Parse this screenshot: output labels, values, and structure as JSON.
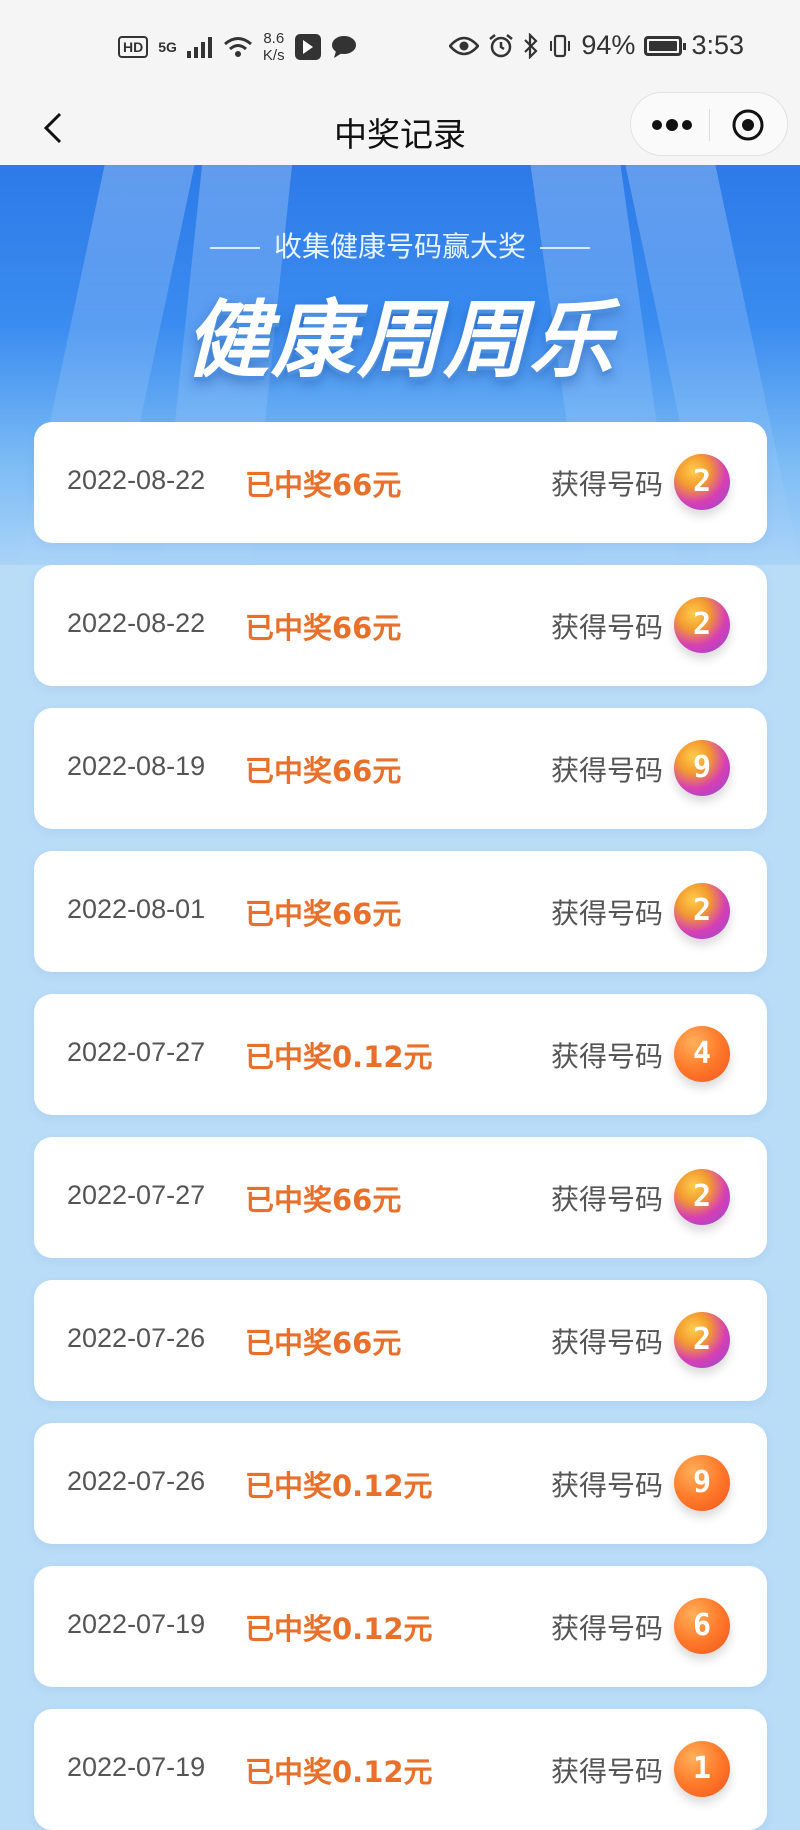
{
  "status_bar": {
    "hd": "HD",
    "net_type": "5G",
    "speed_value": "8.6",
    "speed_unit": "K/s",
    "battery": "94%",
    "time": "3:53"
  },
  "nav": {
    "title": "中奖记录",
    "back_icon": "chevron-left-icon",
    "more_icon": "more-dots-icon",
    "close_icon": "target-circle-icon"
  },
  "banner": {
    "subtitle": "收集健康号码赢大奖",
    "title": "健康周周乐"
  },
  "records": [
    {
      "date": "2022-08-22",
      "prize": "已中奖66元",
      "got_label": "获得号码",
      "number": "2",
      "ball_style": "rainbow"
    },
    {
      "date": "2022-08-22",
      "prize": "已中奖66元",
      "got_label": "获得号码",
      "number": "2",
      "ball_style": "rainbow"
    },
    {
      "date": "2022-08-19",
      "prize": "已中奖66元",
      "got_label": "获得号码",
      "number": "9",
      "ball_style": "rainbow"
    },
    {
      "date": "2022-08-01",
      "prize": "已中奖66元",
      "got_label": "获得号码",
      "number": "2",
      "ball_style": "rainbow"
    },
    {
      "date": "2022-07-27",
      "prize": "已中奖0.12元",
      "got_label": "获得号码",
      "number": "4",
      "ball_style": "orange"
    },
    {
      "date": "2022-07-27",
      "prize": "已中奖66元",
      "got_label": "获得号码",
      "number": "2",
      "ball_style": "rainbow"
    },
    {
      "date": "2022-07-26",
      "prize": "已中奖66元",
      "got_label": "获得号码",
      "number": "2",
      "ball_style": "rainbow"
    },
    {
      "date": "2022-07-26",
      "prize": "已中奖0.12元",
      "got_label": "获得号码",
      "number": "9",
      "ball_style": "orange"
    },
    {
      "date": "2022-07-19",
      "prize": "已中奖0.12元",
      "got_label": "获得号码",
      "number": "6",
      "ball_style": "orange"
    },
    {
      "date": "2022-07-19",
      "prize": "已中奖0.12元",
      "got_label": "获得号码",
      "number": "1",
      "ball_style": "orange"
    }
  ],
  "colors": {
    "accent": "#e8702a",
    "banner_blue": "#2d7ae8",
    "page_bg": "#b9dcf7"
  }
}
